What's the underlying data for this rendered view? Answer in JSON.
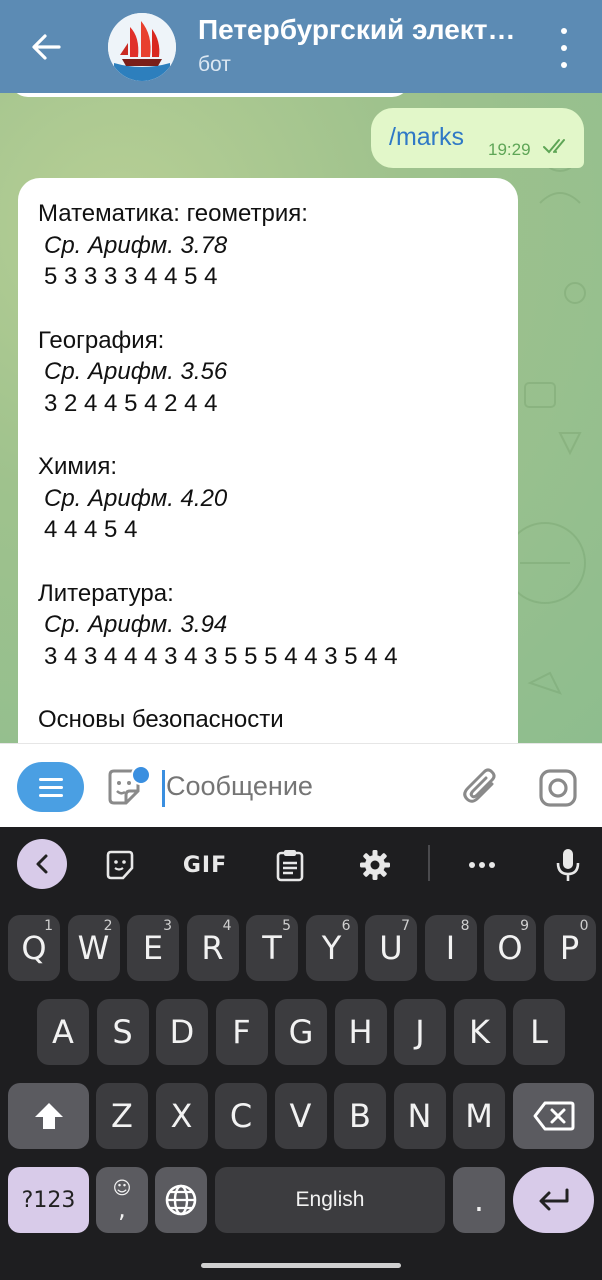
{
  "header": {
    "title": "Петербургский элект…",
    "subtitle": "бот"
  },
  "outgoing": {
    "text": "/marks",
    "time": "19:29"
  },
  "message": {
    "subjects": [
      {
        "name": "Математика: геометрия:",
        "avg": "Ср. Арифм. 3.78",
        "marks": "5 3 3 3 3 4 4 5 4"
      },
      {
        "name": "География:",
        "avg": "Ср. Арифм. 3.56",
        "marks": "3 2 4 4 5 4 2 4 4"
      },
      {
        "name": "Химия:",
        "avg": "Ср. Арифм. 4.20",
        "marks": "4 4 4 5 4"
      },
      {
        "name": "Литература:",
        "avg": "Ср. Арифм. 3.94",
        "marks": "3 4 3 4 4 4 3 4 3 5 5 5 4 4 3 5 4 4"
      },
      {
        "name": "Основы безопасности",
        "avg": "",
        "marks": ""
      }
    ]
  },
  "input": {
    "placeholder": "Сообщение"
  },
  "keyboard": {
    "toolbar": {
      "gif": "GIF"
    },
    "row1": [
      {
        "k": "Q",
        "n": "1"
      },
      {
        "k": "W",
        "n": "2"
      },
      {
        "k": "E",
        "n": "3"
      },
      {
        "k": "R",
        "n": "4"
      },
      {
        "k": "T",
        "n": "5"
      },
      {
        "k": "Y",
        "n": "6"
      },
      {
        "k": "U",
        "n": "7"
      },
      {
        "k": "I",
        "n": "8"
      },
      {
        "k": "O",
        "n": "9"
      },
      {
        "k": "P",
        "n": "0"
      }
    ],
    "row2": [
      "A",
      "S",
      "D",
      "F",
      "G",
      "H",
      "J",
      "K",
      "L"
    ],
    "row3": [
      "Z",
      "X",
      "C",
      "V",
      "B",
      "N",
      "M"
    ],
    "symbols_label": "?123",
    "emoji_comma": ",",
    "space_label": "English",
    "period": "."
  },
  "colors": {
    "header": "#5c8bb4",
    "outgoing_bubble": "#e2f7c9",
    "accent": "#4a9fe3",
    "keyboard_bg": "#1e1e20",
    "key": "#3c3c3f",
    "key_light": "#d8cbe9"
  }
}
